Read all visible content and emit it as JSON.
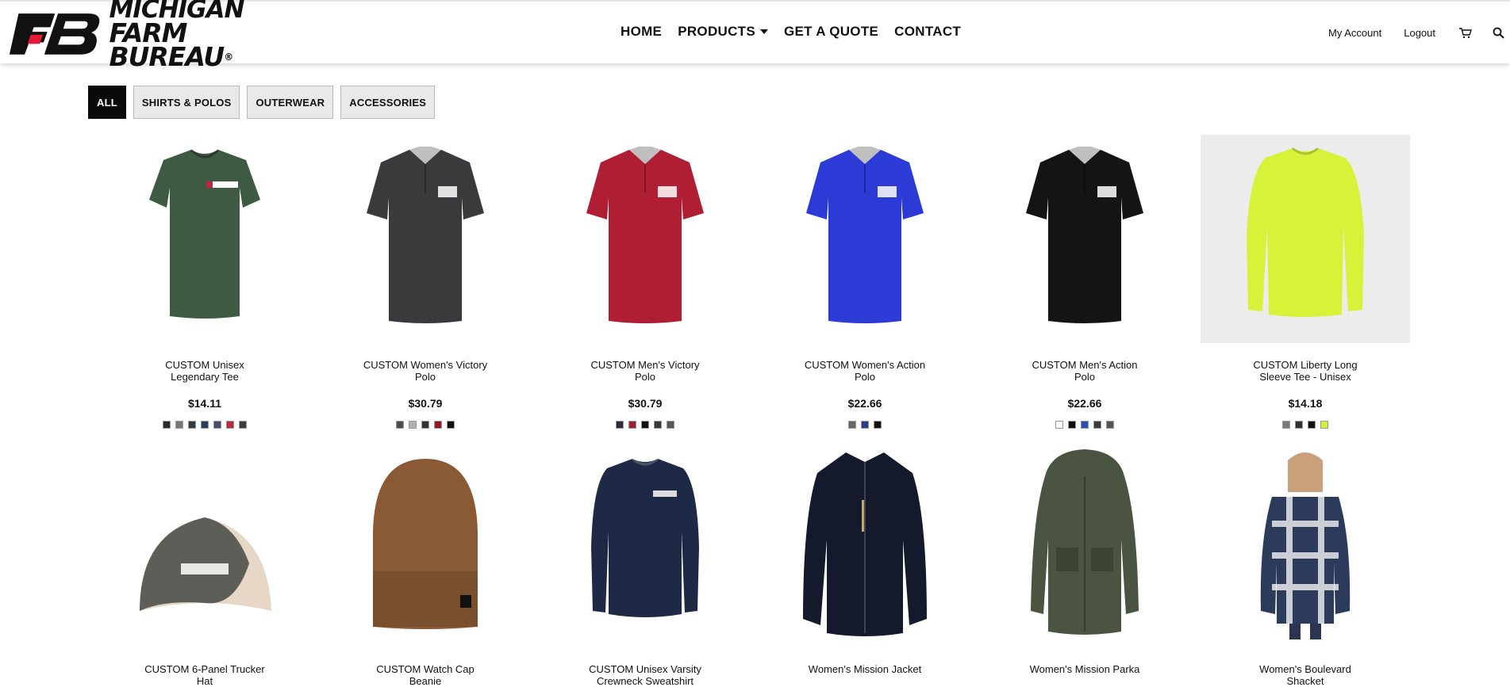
{
  "logo": {
    "line1": "MICHIGAN",
    "line2": "FARM BUREAU",
    "reg": "®"
  },
  "nav": [
    {
      "label": "HOME"
    },
    {
      "label": "PRODUCTS",
      "dropdown": true
    },
    {
      "label": "GET A QUOTE"
    },
    {
      "label": "CONTACT"
    }
  ],
  "utility": {
    "account": "My Account",
    "logout": "Logout",
    "icons": [
      "cart-icon",
      "search-icon"
    ]
  },
  "filters": [
    {
      "label": "ALL",
      "active": true
    },
    {
      "label": "SHIRTS & POLOS",
      "active": false
    },
    {
      "label": "OUTERWEAR",
      "active": false
    },
    {
      "label": "ACCESSORIES",
      "active": false
    }
  ],
  "products": [
    {
      "name": "CUSTOM Unisex Legendary Tee",
      "price": "$14.11",
      "garment": "tee",
      "color": "#3f5a42",
      "swatches": [
        "#2b2b2b",
        "#777777",
        "#2f3a4a",
        "#2a3b5c",
        "#4b4b6a",
        "#c0283f",
        "#3a3f45"
      ]
    },
    {
      "name": "CUSTOM Women's Victory Polo",
      "price": "$30.79",
      "garment": "polo",
      "color": "#3a3a3c",
      "swatches": [
        "#4a4a4a",
        "#b0b0b0",
        "#333333",
        "#8b1a2a",
        "#111111"
      ]
    },
    {
      "name": "CUSTOM Men's Victory Polo",
      "price": "$30.79",
      "garment": "polo",
      "color": "#b01e33",
      "swatches": [
        "#2a2e38",
        "#a01e32",
        "#111111",
        "#3a3a3a",
        "#555555"
      ]
    },
    {
      "name": "CUSTOM Women's Action Polo",
      "price": "$22.66",
      "garment": "polo",
      "color": "#2d3bd6",
      "swatches": [
        "#666666",
        "#2a3f8a",
        "#111111"
      ]
    },
    {
      "name": "CUSTOM Men's Action Polo",
      "price": "$22.66",
      "garment": "polo",
      "color": "#141414",
      "swatches": [
        "#ffffff",
        "#111111",
        "#2a4fb0",
        "#3a3a3a",
        "#555555"
      ]
    },
    {
      "name": "CUSTOM Liberty Long Sleeve Tee - Unisex",
      "price": "$14.18",
      "garment": "longsleeve",
      "color": "#d8f23a",
      "swatches": [
        "#7a7a7a",
        "#2f2f35",
        "#111111",
        "#d4f03c"
      ]
    },
    {
      "name": "CUSTOM 6-Panel Trucker Hat",
      "price": "",
      "garment": "hat",
      "color": "#5e5e58",
      "swatches": []
    },
    {
      "name": "CUSTOM Watch Cap Beanie",
      "price": "",
      "garment": "beanie",
      "color": "#8a5a34",
      "swatches": []
    },
    {
      "name": "CUSTOM Unisex Varsity Crewneck Sweatshirt",
      "price": "",
      "garment": "crewneck",
      "color": "#1e2a45",
      "swatches": []
    },
    {
      "name": "Women's Mission Jacket",
      "price": "",
      "garment": "jacket",
      "color": "#141a2b",
      "swatches": []
    },
    {
      "name": "Women's Mission Parka",
      "price": "",
      "garment": "parka",
      "color": "#4b5440",
      "swatches": []
    },
    {
      "name": "Women's Boulevard Shacket",
      "price": "",
      "garment": "shacket",
      "color": "#2c3b5c",
      "swatches": []
    }
  ]
}
